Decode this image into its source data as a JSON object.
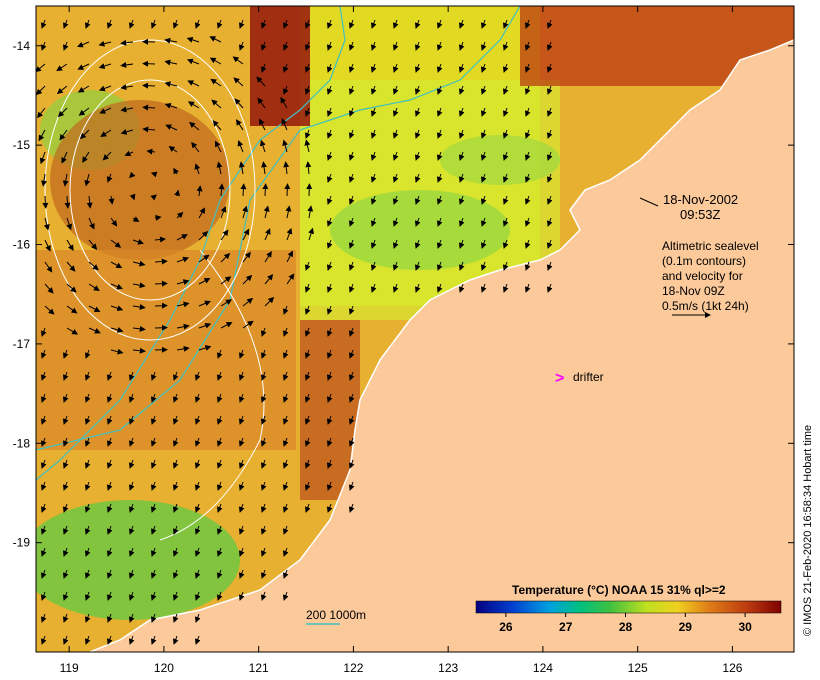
{
  "map": {
    "date": "18-Nov-2002",
    "time": "09:53Z",
    "legend_lines": [
      "Altimetric sealevel",
      "(0.1m contours)",
      "and velocity for",
      "18-Nov 09Z",
      "0.5m/s (1kt 24h)"
    ],
    "drifter_label": "drifter",
    "bathymetry_label": "200  1000m",
    "side_credit": "© IMOS 21-Feb-2020 16:58:34 Hobart time",
    "colorbar": {
      "title": "Temperature (°C) NOAA 15 31% ql>=2",
      "tick_labels": [
        "26",
        "27",
        "28",
        "29",
        "30"
      ],
      "min": 25.5,
      "max": 30.6,
      "ticks": [
        26,
        27,
        28,
        29,
        30
      ]
    },
    "axes": {
      "lon_labels": [
        "119",
        "120",
        "121",
        "122",
        "123",
        "124",
        "125",
        "126"
      ],
      "lat_labels": [
        "-14",
        "-15",
        "-16",
        "-17",
        "-18",
        "-19"
      ],
      "lon_range": [
        118.65,
        126.65
      ],
      "lat_range": [
        -20.1,
        -13.6
      ]
    },
    "colors": {
      "land": "#fbc99a",
      "sst_cold": "#8fd14a",
      "sst_mid": "#f0c020",
      "sst_warm": "#b03010",
      "drifter": "#ff00ff",
      "bathymetry": "#40c0c0",
      "sealevel_contour": "#ffffff"
    }
  }
}
